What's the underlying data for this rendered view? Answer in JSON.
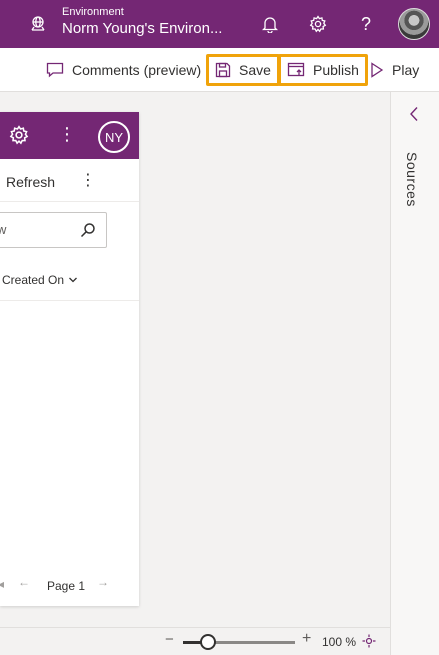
{
  "header": {
    "environment_label": "Environment",
    "environment_name": "Norm Young's Environ...",
    "icons": [
      "environment-icon",
      "bell-icon",
      "gear-icon",
      "help-icon",
      "avatar"
    ]
  },
  "commandbar": {
    "comments_label": "Comments (preview)",
    "save_label": "Save",
    "publish_label": "Publish",
    "play_label": "Play"
  },
  "right_panel": {
    "sources_label": "Sources"
  },
  "app": {
    "avatar_initials": "NY",
    "refresh_label": "Refresh",
    "search_placeholder_partial": "w",
    "column_header": "Created On",
    "page_label": "Page 1"
  },
  "zoom": {
    "minus": "−",
    "plus": "+",
    "value_label": "100 %",
    "level_fraction": 0.22
  },
  "colors": {
    "brand_purple": "#742774",
    "highlight_orange": "#f0a30a"
  }
}
